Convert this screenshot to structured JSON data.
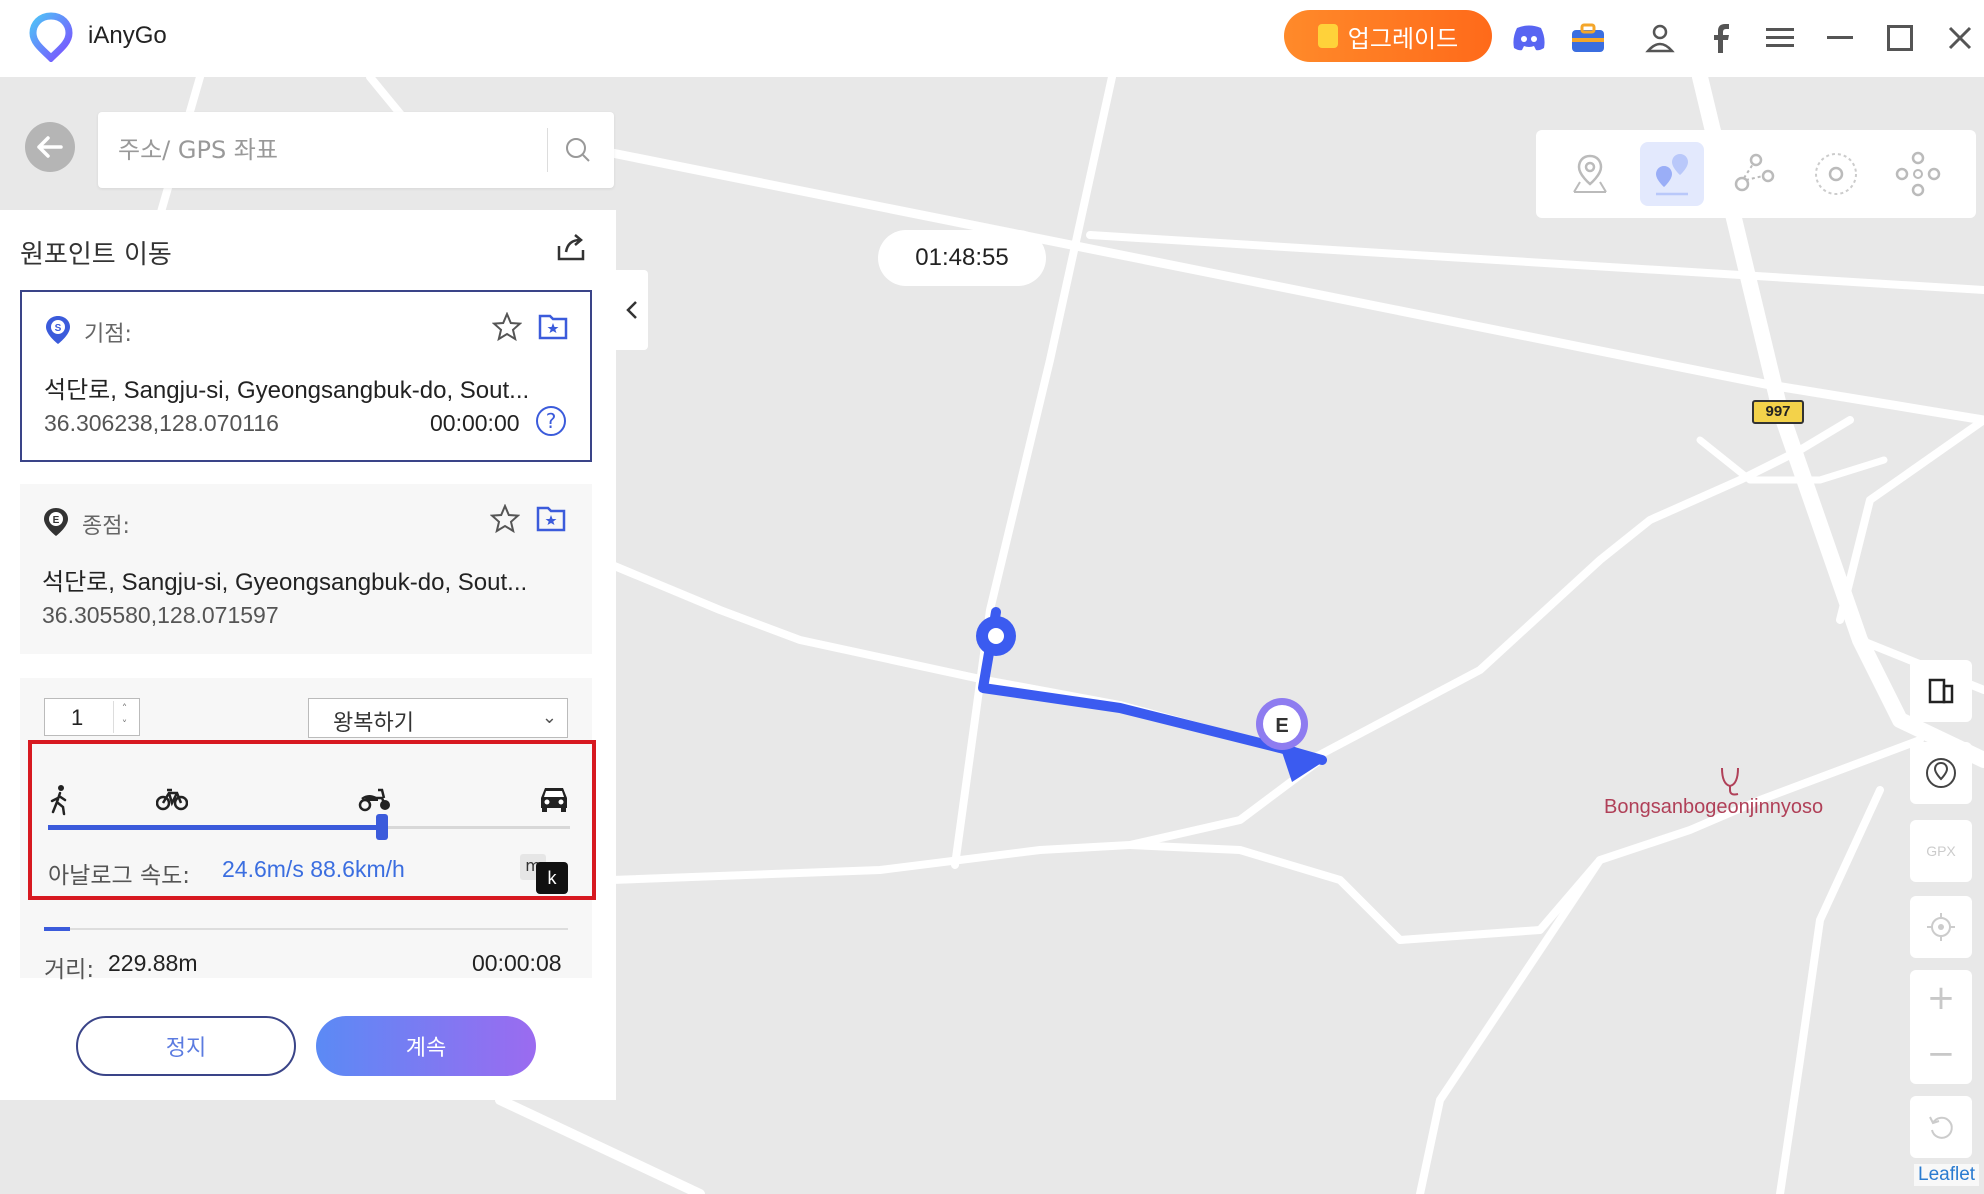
{
  "app": {
    "name": "iAnyGo"
  },
  "titlebar": {
    "upgrade_label": "업그레이드",
    "icons": [
      "discord-icon",
      "toolbox-icon",
      "user-icon",
      "facebook-icon",
      "menu-icon",
      "minimize-icon",
      "maximize-icon",
      "close-icon"
    ]
  },
  "search": {
    "placeholder": "주소/ GPS 좌표",
    "value": ""
  },
  "panel": {
    "title": "원포인트 이동",
    "start": {
      "label": "기점:",
      "address": "석단로, Sangju-si, Gyeongsangbuk-do, Sout...",
      "coords": "36.306238,128.070116",
      "time": "00:00:00"
    },
    "end": {
      "label": "종점:",
      "address": "석단로, Sangju-si, Gyeongsangbuk-do, Sout...",
      "coords": "36.305580,128.071597"
    },
    "repeat_count": "1",
    "repeat_mode": "왕복하기",
    "speed": {
      "label": "아날로그 속도:",
      "value": "24.6m/s 88.6km/h",
      "slider_fraction": 0.64,
      "unit_m": "m",
      "unit_k": "k",
      "modes": [
        "walk-icon",
        "bicycle-icon",
        "scooter-icon",
        "car-icon"
      ]
    },
    "progress_fraction": 0.05,
    "distance_label": "거리:",
    "distance": "229.88m",
    "elapsed": "00:00:08",
    "stop_label": "정지",
    "continue_label": "계속"
  },
  "map": {
    "timer": "01:48:55",
    "poi": "Bongsanbogeonjinnyoso",
    "road_number": "997",
    "end_marker": "E",
    "attribution": "Leaflet",
    "gpx_label": "GPX",
    "route_color": "#3b5bf0",
    "accent": "#3b5bdb"
  }
}
